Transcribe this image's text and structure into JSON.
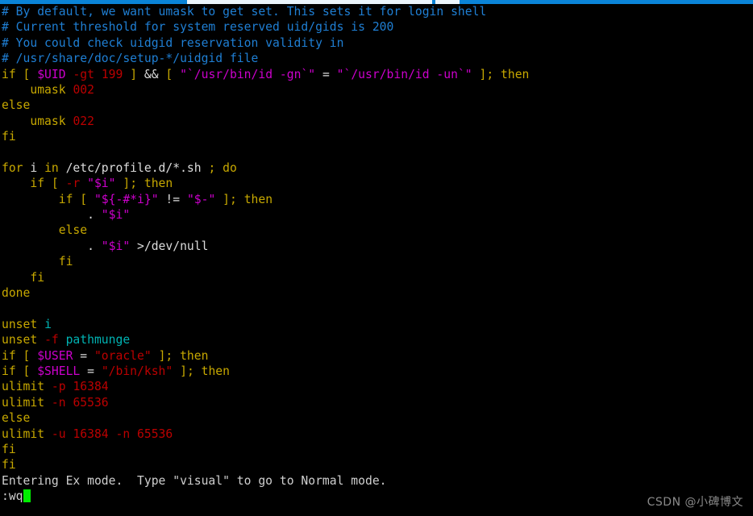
{
  "window": {
    "titlebar_color": "#0a84d8"
  },
  "terminal": {
    "background": "#000000",
    "cursor_color": "#00ee00",
    "cursor_char": " ",
    "colors": {
      "comment": "#1f7fd4",
      "keyword": "#c7a800",
      "variable": "#cc00cc",
      "string_magenta": "#cc00cc",
      "string_red": "#bb0000",
      "number": "#bb0000",
      "plain": "#cfcfcf",
      "identifier": "#00b3b3"
    },
    "lines": [
      {
        "id": "line-1",
        "spans": [
          {
            "text": "# By default, we want umask to get set. This sets it for login shell",
            "cls": "c-comment"
          }
        ]
      },
      {
        "id": "line-2",
        "spans": [
          {
            "text": "# Current threshold for system reserved uid/gids is 200",
            "cls": "c-comment"
          }
        ]
      },
      {
        "id": "line-3",
        "spans": [
          {
            "text": "# You could check uidgid reservation validity in",
            "cls": "c-comment"
          }
        ]
      },
      {
        "id": "line-4",
        "spans": [
          {
            "text": "# /usr/share/doc/setup-*/uidgid file",
            "cls": "c-comment"
          }
        ]
      },
      {
        "id": "line-5",
        "spans": [
          {
            "text": "if",
            "cls": "c-keyword"
          },
          {
            "text": " ",
            "cls": "c-plain"
          },
          {
            "text": "[",
            "cls": "c-punct"
          },
          {
            "text": " ",
            "cls": "c-plain"
          },
          {
            "text": "$UID",
            "cls": "c-var"
          },
          {
            "text": " ",
            "cls": "c-plain"
          },
          {
            "text": "-gt",
            "cls": "c-flag"
          },
          {
            "text": " ",
            "cls": "c-plain"
          },
          {
            "text": "199",
            "cls": "c-number"
          },
          {
            "text": " ",
            "cls": "c-plain"
          },
          {
            "text": "]",
            "cls": "c-punct"
          },
          {
            "text": " ",
            "cls": "c-plain"
          },
          {
            "text": "&&",
            "cls": "c-white"
          },
          {
            "text": " ",
            "cls": "c-plain"
          },
          {
            "text": "[",
            "cls": "c-punct"
          },
          {
            "text": " ",
            "cls": "c-plain"
          },
          {
            "text": "\"`/usr/bin/id -gn`\"",
            "cls": "c-string"
          },
          {
            "text": " ",
            "cls": "c-plain"
          },
          {
            "text": "=",
            "cls": "c-white"
          },
          {
            "text": " ",
            "cls": "c-plain"
          },
          {
            "text": "\"`/usr/bin/id -un`\"",
            "cls": "c-string"
          },
          {
            "text": " ",
            "cls": "c-plain"
          },
          {
            "text": "]",
            "cls": "c-punct"
          },
          {
            "text": ";",
            "cls": "c-punct"
          },
          {
            "text": " ",
            "cls": "c-plain"
          },
          {
            "text": "then",
            "cls": "c-keyword"
          }
        ]
      },
      {
        "id": "line-6",
        "spans": [
          {
            "text": "    umask ",
            "cls": "c-keyword"
          },
          {
            "text": "002",
            "cls": "c-number"
          }
        ]
      },
      {
        "id": "line-7",
        "spans": [
          {
            "text": "else",
            "cls": "c-keyword"
          }
        ]
      },
      {
        "id": "line-8",
        "spans": [
          {
            "text": "    umask ",
            "cls": "c-keyword"
          },
          {
            "text": "022",
            "cls": "c-number"
          }
        ]
      },
      {
        "id": "line-9",
        "spans": [
          {
            "text": "fi",
            "cls": "c-keyword"
          }
        ]
      },
      {
        "id": "line-10",
        "spans": [
          {
            "text": "",
            "cls": "c-plain"
          }
        ]
      },
      {
        "id": "line-11",
        "spans": [
          {
            "text": "for",
            "cls": "c-keyword"
          },
          {
            "text": " ",
            "cls": "c-plain"
          },
          {
            "text": "i",
            "cls": "c-white"
          },
          {
            "text": " ",
            "cls": "c-plain"
          },
          {
            "text": "in",
            "cls": "c-keyword"
          },
          {
            "text": " /etc/profile.d/*.sh ",
            "cls": "c-white"
          },
          {
            "text": ";",
            "cls": "c-punct"
          },
          {
            "text": " ",
            "cls": "c-plain"
          },
          {
            "text": "do",
            "cls": "c-keyword"
          }
        ]
      },
      {
        "id": "line-12",
        "spans": [
          {
            "text": "    ",
            "cls": "c-plain"
          },
          {
            "text": "if",
            "cls": "c-keyword"
          },
          {
            "text": " ",
            "cls": "c-plain"
          },
          {
            "text": "[",
            "cls": "c-punct"
          },
          {
            "text": " ",
            "cls": "c-plain"
          },
          {
            "text": "-r",
            "cls": "c-flag"
          },
          {
            "text": " ",
            "cls": "c-plain"
          },
          {
            "text": "\"$i\"",
            "cls": "c-string"
          },
          {
            "text": " ",
            "cls": "c-plain"
          },
          {
            "text": "]",
            "cls": "c-punct"
          },
          {
            "text": ";",
            "cls": "c-punct"
          },
          {
            "text": " ",
            "cls": "c-plain"
          },
          {
            "text": "then",
            "cls": "c-keyword"
          }
        ]
      },
      {
        "id": "line-13",
        "spans": [
          {
            "text": "        ",
            "cls": "c-plain"
          },
          {
            "text": "if",
            "cls": "c-keyword"
          },
          {
            "text": " ",
            "cls": "c-plain"
          },
          {
            "text": "[",
            "cls": "c-punct"
          },
          {
            "text": " ",
            "cls": "c-plain"
          },
          {
            "text": "\"${-#*i}\"",
            "cls": "c-string"
          },
          {
            "text": " ",
            "cls": "c-plain"
          },
          {
            "text": "!=",
            "cls": "c-white"
          },
          {
            "text": " ",
            "cls": "c-plain"
          },
          {
            "text": "\"$-\"",
            "cls": "c-string"
          },
          {
            "text": " ",
            "cls": "c-plain"
          },
          {
            "text": "]",
            "cls": "c-punct"
          },
          {
            "text": ";",
            "cls": "c-punct"
          },
          {
            "text": " ",
            "cls": "c-plain"
          },
          {
            "text": "then",
            "cls": "c-keyword"
          }
        ]
      },
      {
        "id": "line-14",
        "spans": [
          {
            "text": "            . ",
            "cls": "c-white"
          },
          {
            "text": "\"$i\"",
            "cls": "c-string"
          }
        ]
      },
      {
        "id": "line-15",
        "spans": [
          {
            "text": "        ",
            "cls": "c-plain"
          },
          {
            "text": "else",
            "cls": "c-keyword"
          }
        ]
      },
      {
        "id": "line-16",
        "spans": [
          {
            "text": "            . ",
            "cls": "c-white"
          },
          {
            "text": "\"$i\"",
            "cls": "c-string"
          },
          {
            "text": " >/dev/null",
            "cls": "c-white"
          }
        ]
      },
      {
        "id": "line-17",
        "spans": [
          {
            "text": "        ",
            "cls": "c-plain"
          },
          {
            "text": "fi",
            "cls": "c-keyword"
          }
        ]
      },
      {
        "id": "line-18",
        "spans": [
          {
            "text": "    ",
            "cls": "c-plain"
          },
          {
            "text": "fi",
            "cls": "c-keyword"
          }
        ]
      },
      {
        "id": "line-19",
        "spans": [
          {
            "text": "done",
            "cls": "c-keyword"
          }
        ]
      },
      {
        "id": "line-20",
        "spans": [
          {
            "text": "",
            "cls": "c-plain"
          }
        ]
      },
      {
        "id": "line-21",
        "spans": [
          {
            "text": "unset",
            "cls": "c-keyword"
          },
          {
            "text": " ",
            "cls": "c-plain"
          },
          {
            "text": "i",
            "cls": "c-ident"
          }
        ]
      },
      {
        "id": "line-22",
        "spans": [
          {
            "text": "unset",
            "cls": "c-keyword"
          },
          {
            "text": " ",
            "cls": "c-plain"
          },
          {
            "text": "-f",
            "cls": "c-flag"
          },
          {
            "text": " ",
            "cls": "c-plain"
          },
          {
            "text": "pathmunge",
            "cls": "c-ident"
          }
        ]
      },
      {
        "id": "line-23",
        "spans": [
          {
            "text": "if",
            "cls": "c-keyword"
          },
          {
            "text": " ",
            "cls": "c-plain"
          },
          {
            "text": "[",
            "cls": "c-punct"
          },
          {
            "text": " ",
            "cls": "c-plain"
          },
          {
            "text": "$USER",
            "cls": "c-var"
          },
          {
            "text": " ",
            "cls": "c-plain"
          },
          {
            "text": "=",
            "cls": "c-white"
          },
          {
            "text": " ",
            "cls": "c-plain"
          },
          {
            "text": "\"oracle\"",
            "cls": "c-string-r"
          },
          {
            "text": " ",
            "cls": "c-plain"
          },
          {
            "text": "]",
            "cls": "c-punct"
          },
          {
            "text": ";",
            "cls": "c-punct"
          },
          {
            "text": " ",
            "cls": "c-plain"
          },
          {
            "text": "then",
            "cls": "c-keyword"
          }
        ]
      },
      {
        "id": "line-24",
        "spans": [
          {
            "text": "if",
            "cls": "c-keyword"
          },
          {
            "text": " ",
            "cls": "c-plain"
          },
          {
            "text": "[",
            "cls": "c-punct"
          },
          {
            "text": " ",
            "cls": "c-plain"
          },
          {
            "text": "$SHELL",
            "cls": "c-var"
          },
          {
            "text": " ",
            "cls": "c-plain"
          },
          {
            "text": "=",
            "cls": "c-white"
          },
          {
            "text": " ",
            "cls": "c-plain"
          },
          {
            "text": "\"/bin/ksh\"",
            "cls": "c-string-r"
          },
          {
            "text": " ",
            "cls": "c-plain"
          },
          {
            "text": "]",
            "cls": "c-punct"
          },
          {
            "text": ";",
            "cls": "c-punct"
          },
          {
            "text": " ",
            "cls": "c-plain"
          },
          {
            "text": "then",
            "cls": "c-keyword"
          }
        ]
      },
      {
        "id": "line-25",
        "spans": [
          {
            "text": "ulimit",
            "cls": "c-keyword"
          },
          {
            "text": " ",
            "cls": "c-plain"
          },
          {
            "text": "-p",
            "cls": "c-flag"
          },
          {
            "text": " ",
            "cls": "c-plain"
          },
          {
            "text": "16384",
            "cls": "c-number"
          }
        ]
      },
      {
        "id": "line-26",
        "spans": [
          {
            "text": "ulimit",
            "cls": "c-keyword"
          },
          {
            "text": " ",
            "cls": "c-plain"
          },
          {
            "text": "-n",
            "cls": "c-flag"
          },
          {
            "text": " ",
            "cls": "c-plain"
          },
          {
            "text": "65536",
            "cls": "c-number"
          }
        ]
      },
      {
        "id": "line-27",
        "spans": [
          {
            "text": "else",
            "cls": "c-keyword"
          }
        ]
      },
      {
        "id": "line-28",
        "spans": [
          {
            "text": "ulimit",
            "cls": "c-keyword"
          },
          {
            "text": " ",
            "cls": "c-plain"
          },
          {
            "text": "-u",
            "cls": "c-flag"
          },
          {
            "text": " ",
            "cls": "c-plain"
          },
          {
            "text": "16384",
            "cls": "c-number"
          },
          {
            "text": " ",
            "cls": "c-plain"
          },
          {
            "text": "-n",
            "cls": "c-flag"
          },
          {
            "text": " ",
            "cls": "c-plain"
          },
          {
            "text": "65536",
            "cls": "c-number"
          }
        ]
      },
      {
        "id": "line-29",
        "spans": [
          {
            "text": "fi",
            "cls": "c-keyword"
          }
        ]
      },
      {
        "id": "line-30",
        "spans": [
          {
            "text": "fi",
            "cls": "c-keyword"
          }
        ]
      },
      {
        "id": "line-31",
        "spans": [
          {
            "text": "Entering Ex mode.  Type \"visual\" to go to Normal mode.",
            "cls": "c-plain"
          }
        ]
      }
    ],
    "prompt": {
      "text": ":wq"
    }
  },
  "watermark": {
    "text": "CSDN @小碑博文"
  }
}
